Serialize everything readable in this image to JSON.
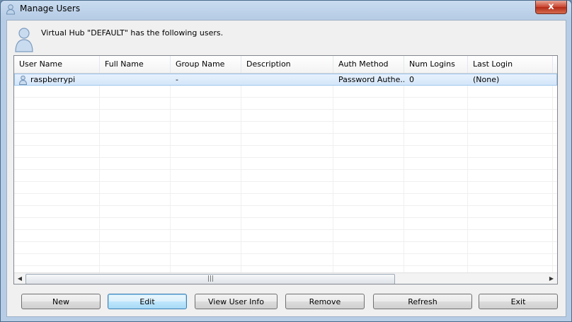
{
  "window": {
    "title": "Manage Users",
    "close_label": "x"
  },
  "header": {
    "text": "Virtual Hub \"DEFAULT\" has the following users."
  },
  "columns": [
    {
      "label": "User Name"
    },
    {
      "label": "Full Name"
    },
    {
      "label": "Group Name"
    },
    {
      "label": "Description"
    },
    {
      "label": "Auth Method"
    },
    {
      "label": "Num Logins"
    },
    {
      "label": "Last Login"
    }
  ],
  "users": [
    {
      "user_name": "raspberrypi",
      "full_name": "",
      "group_name": "-",
      "description": "",
      "auth_method": "Password Authe...",
      "num_logins": "0",
      "last_login": "(None)"
    }
  ],
  "scrollbar": {
    "left_arrow": "◀",
    "right_arrow": "▶",
    "grip": "|||"
  },
  "buttons": {
    "new": "New",
    "edit": "Edit",
    "view_user_info": "View User Info",
    "remove": "Remove",
    "refresh": "Refresh",
    "exit": "Exit"
  }
}
